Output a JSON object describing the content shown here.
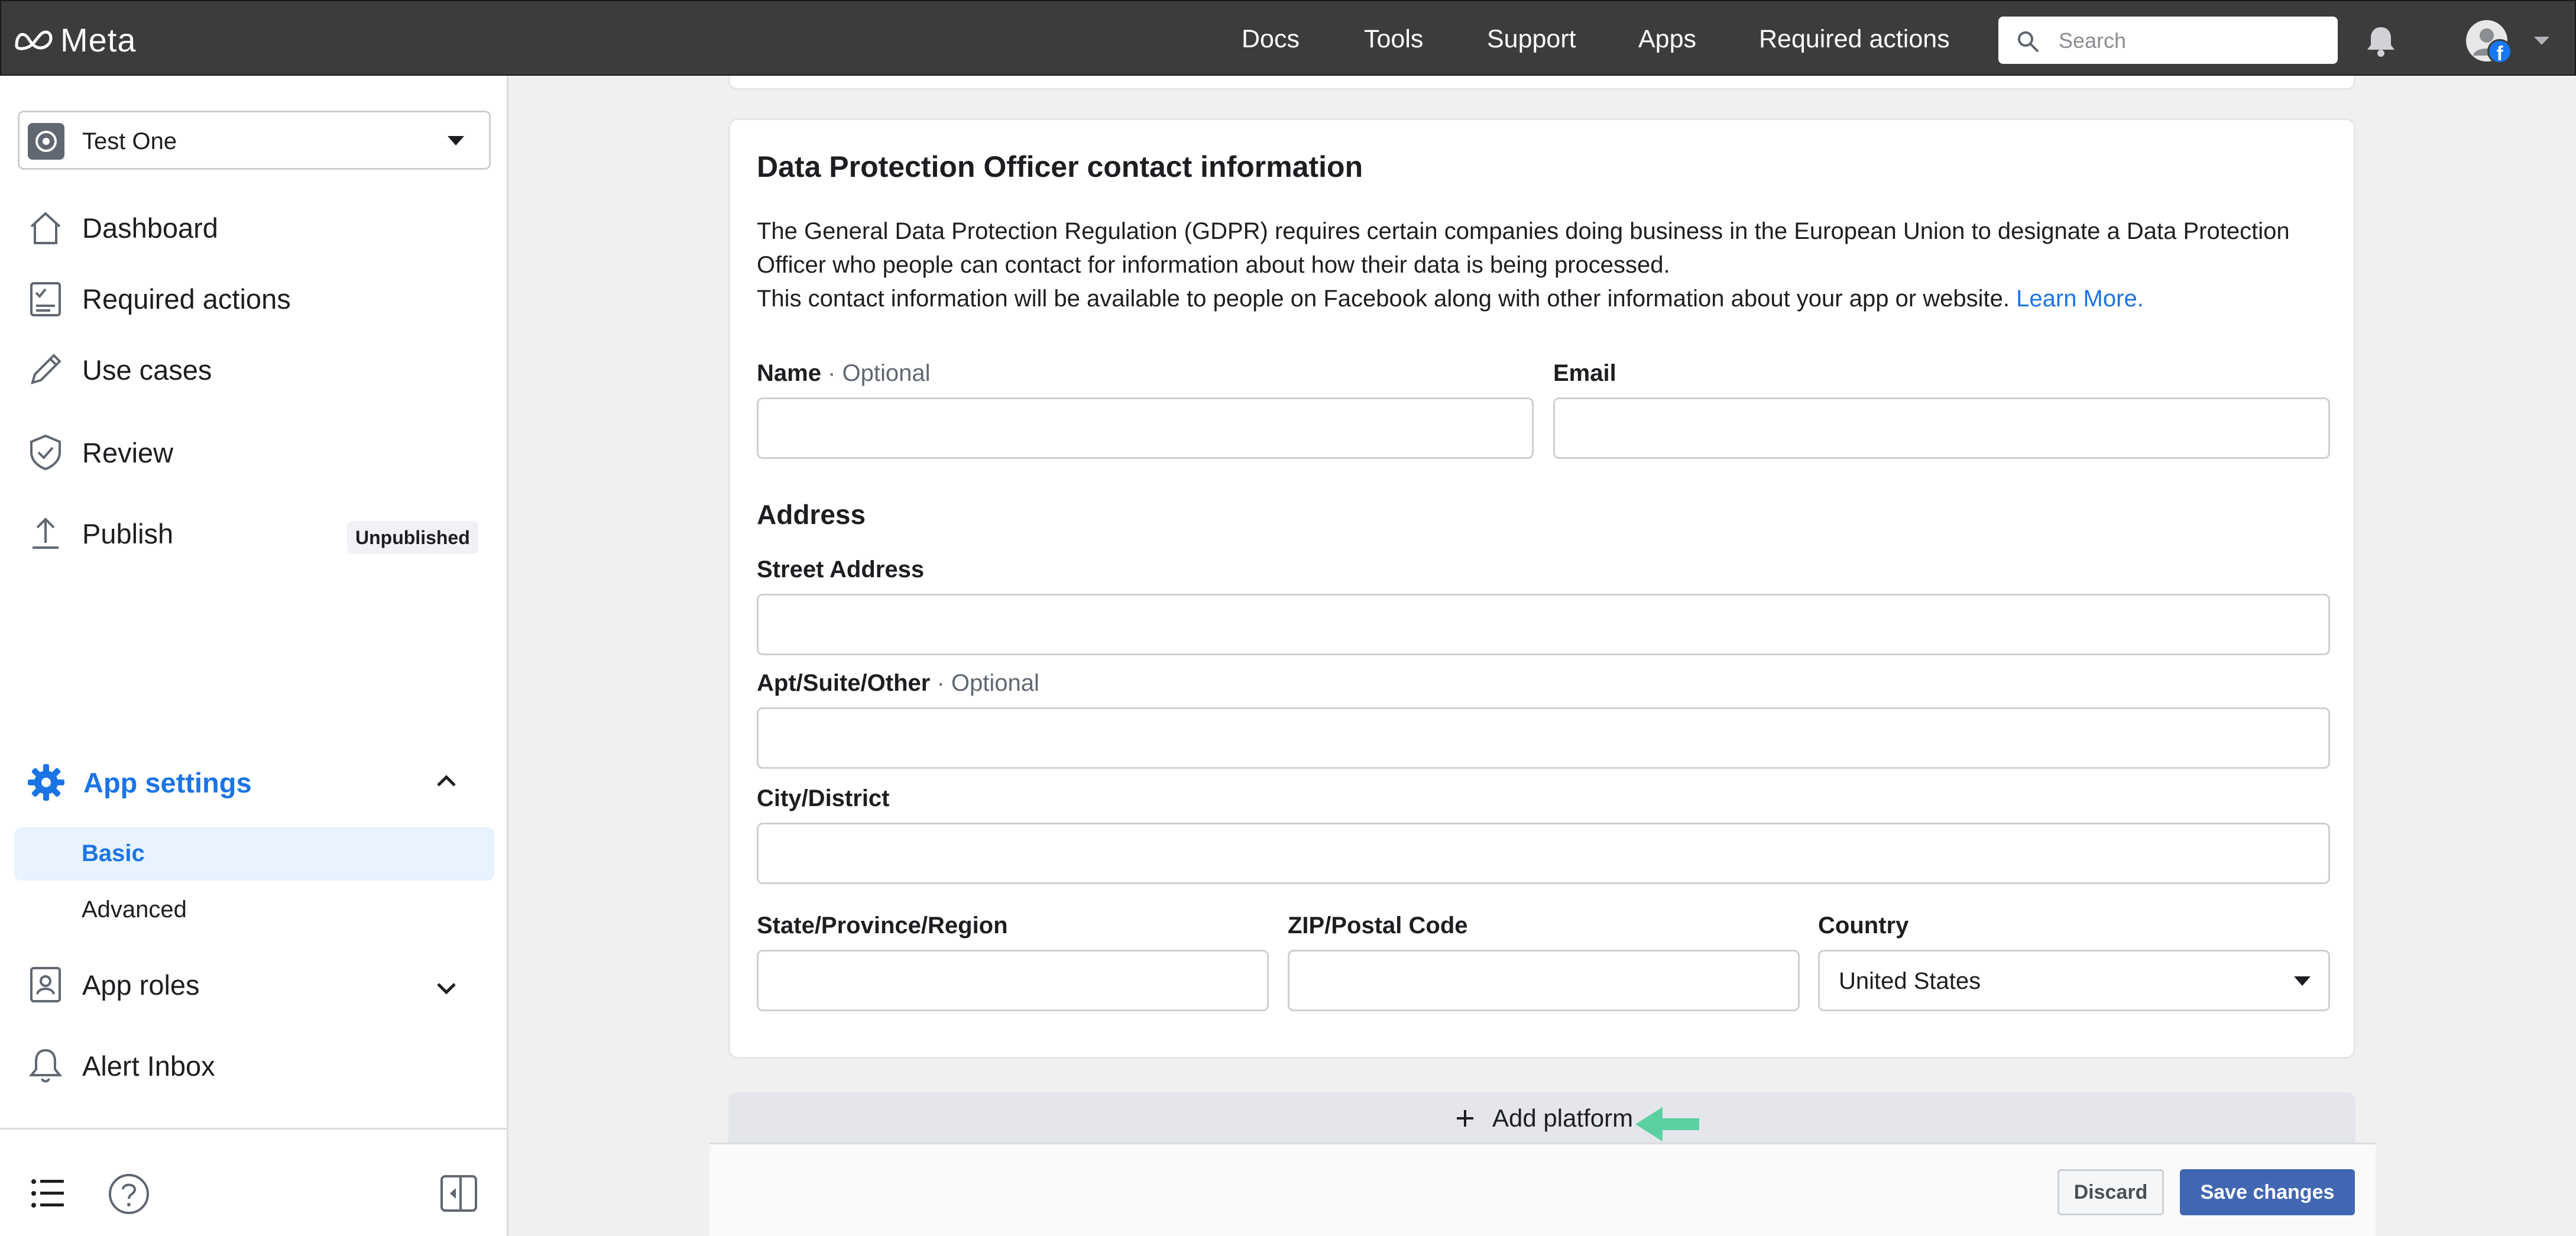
{
  "topbar": {
    "brand": "Meta",
    "nav": [
      "Docs",
      "Tools",
      "Support",
      "Apps",
      "Required actions"
    ],
    "search_placeholder": "Search",
    "icons": [
      "meta-logo-icon",
      "search-icon",
      "bell-icon",
      "facebook-badge-icon",
      "caret-down-icon"
    ]
  },
  "sidebar": {
    "app_name": "Test One",
    "items": {
      "dashboard": "Dashboard",
      "required_actions": "Required actions",
      "use_cases": "Use cases",
      "review": "Review",
      "publish": "Publish",
      "publish_badge": "Unpublished",
      "app_settings": "App settings",
      "basic": "Basic",
      "advanced": "Advanced",
      "app_roles": "App roles",
      "alert_inbox": "Alert Inbox"
    }
  },
  "dpo": {
    "title": "Data Protection Officer contact information",
    "desc_line1": "The General Data Protection Regulation (GDPR) requires certain companies doing business in the European Union to designate a Data Protection",
    "desc_line2": "Officer who people can contact for information about how their data is being processed.",
    "desc_line3": "This contact information will be available to people on Facebook along with other information about your app or website.",
    "learn_more": "Learn More.",
    "name_label": "Name",
    "optional_suffix": " · Optional",
    "email_label": "Email",
    "address_heading": "Address",
    "street_label": "Street Address",
    "apt_label": "Apt/Suite/Other",
    "city_label": "City/District",
    "state_label": "State/Province/Region",
    "zip_label": "ZIP/Postal Code",
    "country_label": "Country",
    "country_value": "United States"
  },
  "add_platform": "Add platform",
  "footer": {
    "discard": "Discard",
    "save": "Save changes"
  },
  "colors": {
    "topbar": "#3c3c3c",
    "accent": "#1b74e4",
    "save_button": "#4267b2",
    "arrow": "#5bd0a0"
  }
}
